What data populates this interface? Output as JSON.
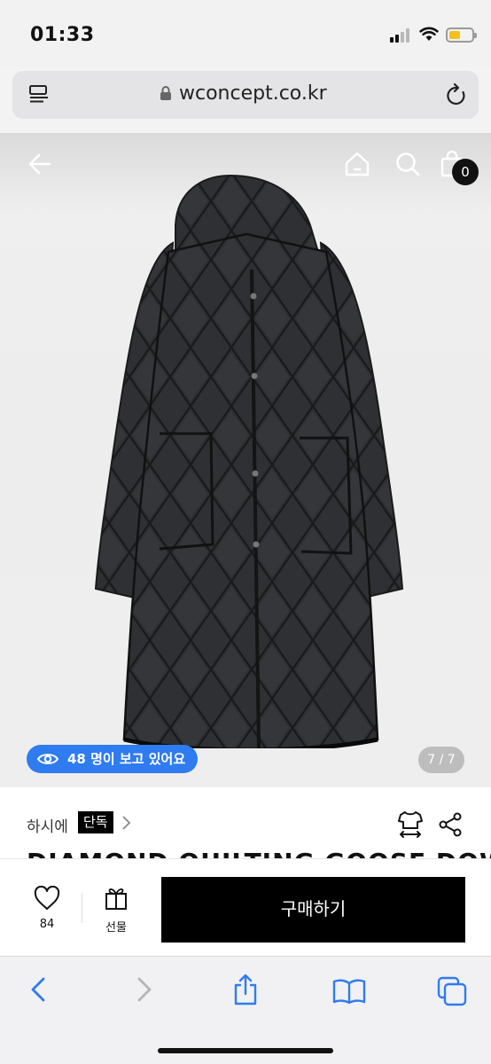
{
  "status_bar": {
    "time": "01:33",
    "battery_color": "#f3c11b"
  },
  "browser": {
    "url": "wconcept.co.kr"
  },
  "header": {
    "cart_count": "0"
  },
  "hero": {
    "viewers_text": "48 명이 보고 있어요",
    "page_indicator": "7 / 7",
    "accent_color": "#2f7bf0"
  },
  "product": {
    "brand": "하시에",
    "exclusive_badge": "단독",
    "title": "DIAMOND QUILTING GOOSE DOWN"
  },
  "purchase_bar": {
    "like_count": "84",
    "gift_label": "선물",
    "buy_label": "구매하기"
  },
  "icons": [
    "reader-icon",
    "lock-icon",
    "reload-icon",
    "back-icon",
    "home-icon",
    "search-icon",
    "bag-icon",
    "eye-icon",
    "chevron-right-icon",
    "size-guide-icon",
    "share-icon",
    "heart-icon",
    "gift-icon",
    "safari-back-icon",
    "safari-forward-icon",
    "safari-share-icon",
    "bookmarks-icon",
    "tabs-icon"
  ]
}
